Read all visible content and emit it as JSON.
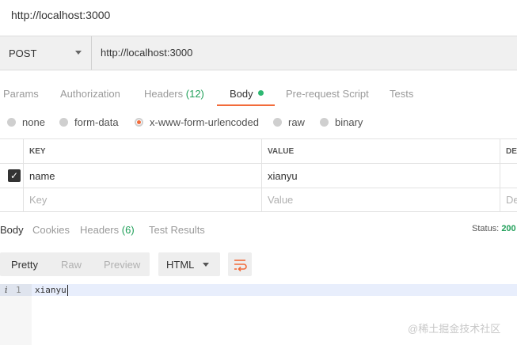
{
  "window": {
    "title": "http://localhost:3000"
  },
  "request": {
    "method": "POST",
    "url": "http://localhost:3000"
  },
  "request_tabs": [
    {
      "label": "Params"
    },
    {
      "label": "Authorization"
    },
    {
      "label": "Headers",
      "count": "(12)"
    },
    {
      "label": "Body",
      "active": true
    },
    {
      "label": "Pre-request Script"
    },
    {
      "label": "Tests"
    }
  ],
  "body_types": [
    {
      "label": "none",
      "selected": false
    },
    {
      "label": "form-data",
      "selected": false
    },
    {
      "label": "x-www-form-urlencoded",
      "selected": true
    },
    {
      "label": "raw",
      "selected": false
    },
    {
      "label": "binary",
      "selected": false
    }
  ],
  "table": {
    "headers": {
      "key": "KEY",
      "value": "VALUE",
      "description": "DES"
    },
    "rows": [
      {
        "checked": true,
        "key": "name",
        "value": "xianyu"
      }
    ],
    "placeholder": {
      "key": "Key",
      "value": "Value",
      "description": "De"
    }
  },
  "response_tabs": [
    {
      "label": "Body",
      "active": true
    },
    {
      "label": "Cookies"
    },
    {
      "label": "Headers",
      "count": "(6)"
    },
    {
      "label": "Test Results"
    }
  ],
  "status": {
    "label": "Status:",
    "value": "200"
  },
  "view_modes": [
    "Pretty",
    "Raw",
    "Preview"
  ],
  "format": "HTML",
  "code": {
    "line_number": "1",
    "info_glyph": "i",
    "text": "xianyu"
  },
  "watermark": "@稀土掘金技术社区",
  "colors": {
    "accent": "#f26b3a",
    "green": "#21a05a",
    "dot": "#2eb872"
  }
}
